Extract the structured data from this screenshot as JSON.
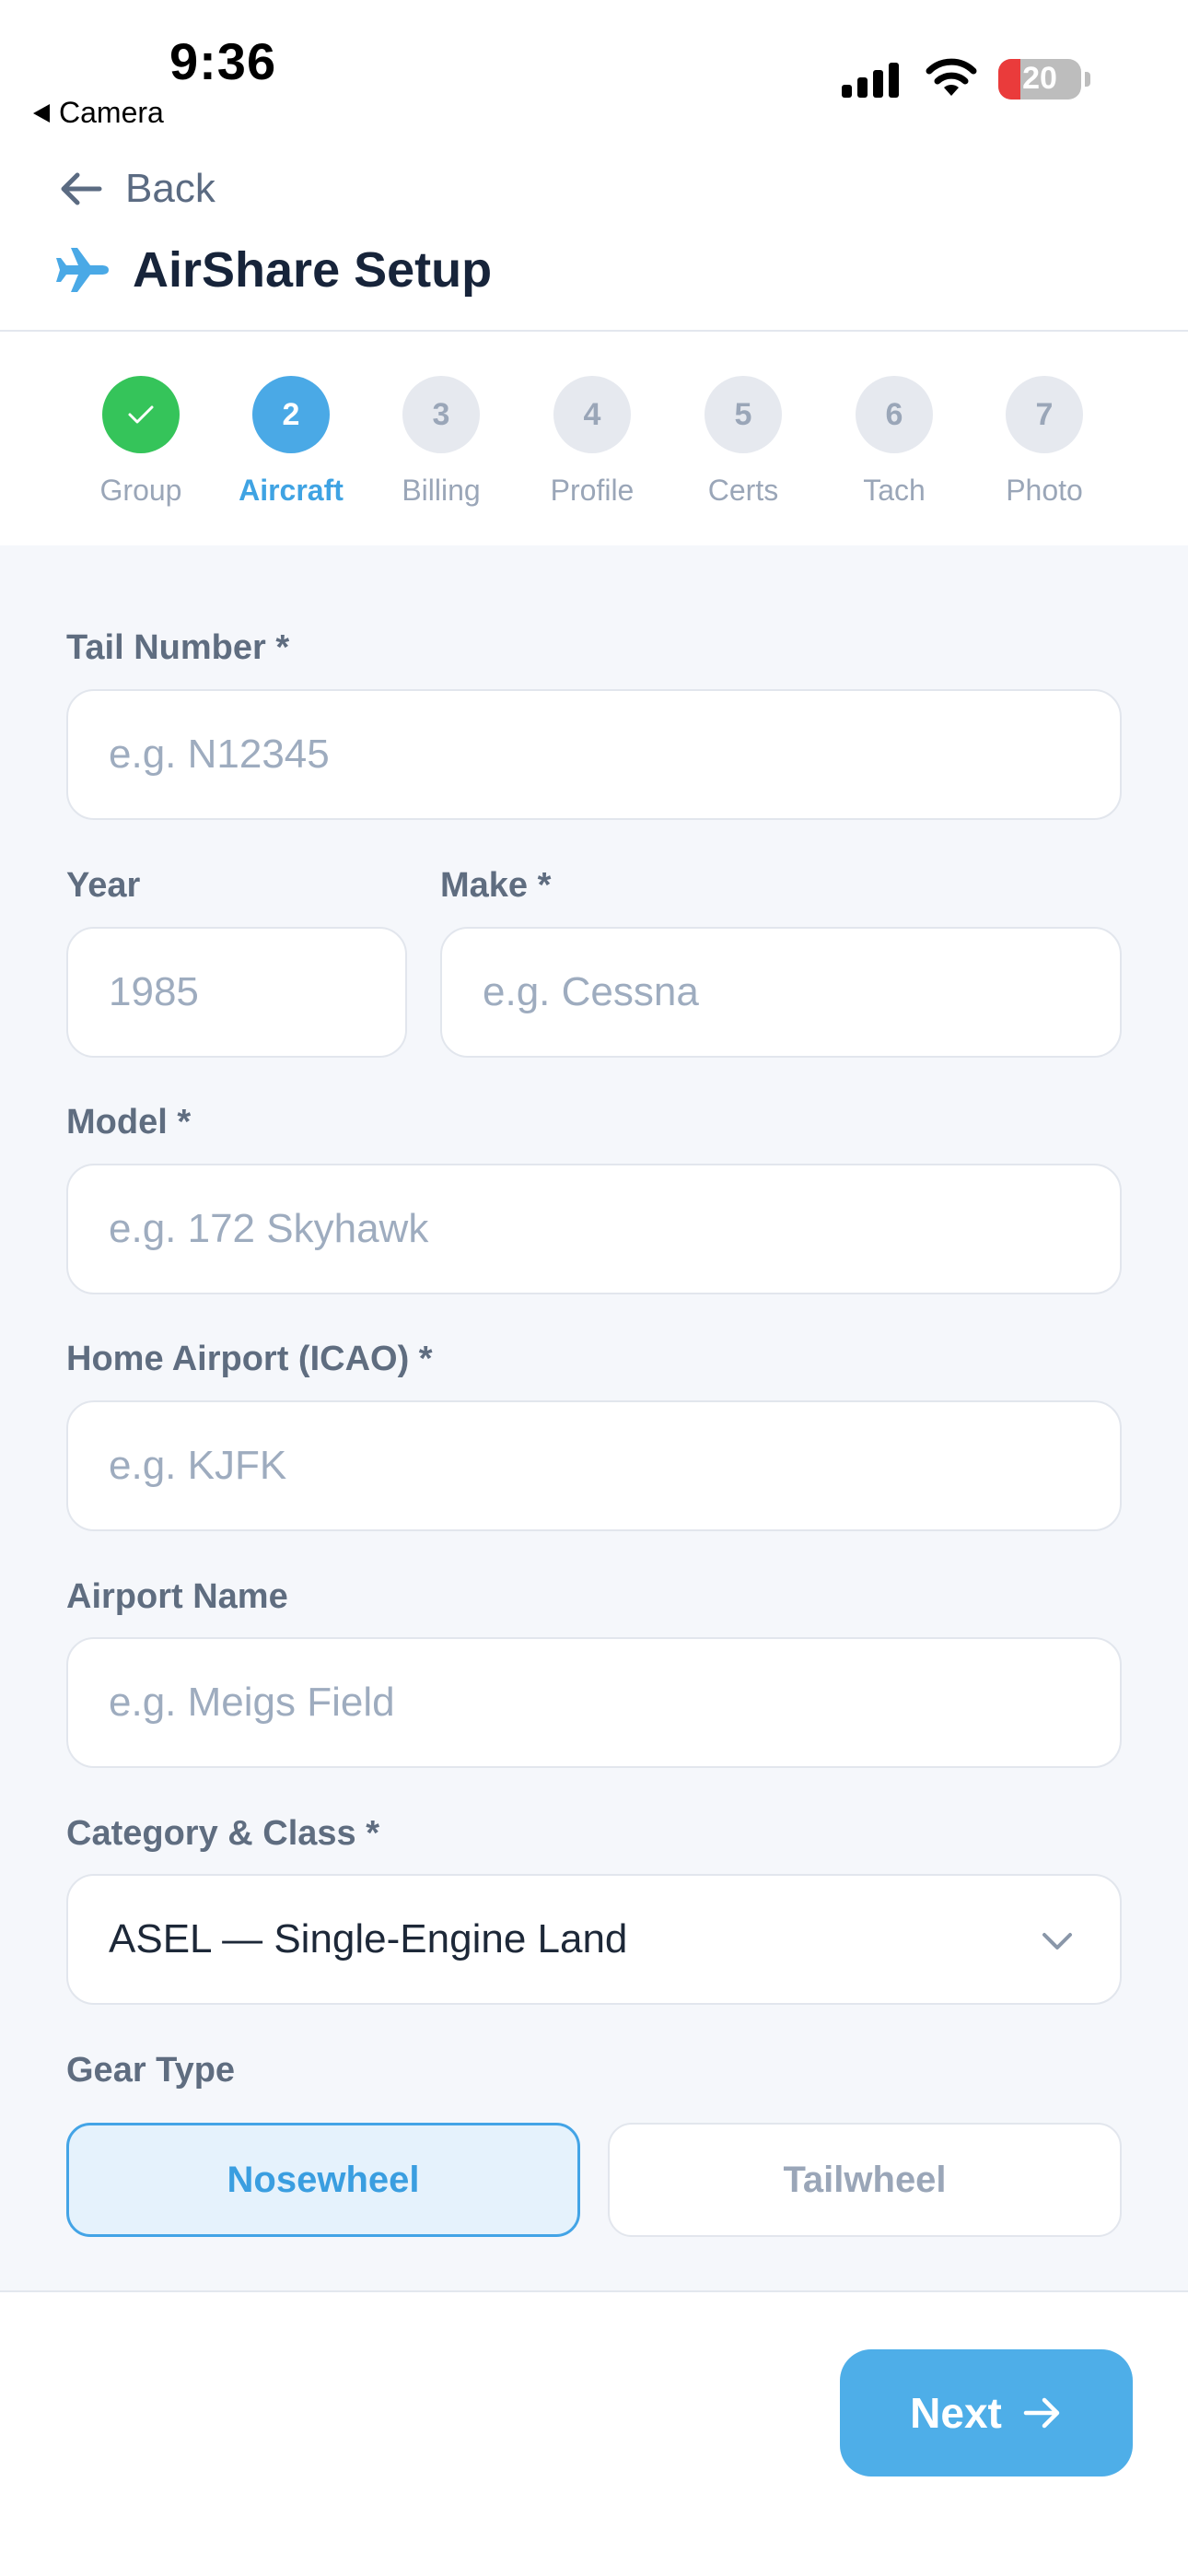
{
  "status_bar": {
    "time": "9:36",
    "back_app": "Camera",
    "battery": "20"
  },
  "header": {
    "back_label": "Back",
    "title": "AirShare Setup"
  },
  "stepper": {
    "steps": [
      {
        "number": "✓",
        "label": "Group",
        "state": "done"
      },
      {
        "number": "2",
        "label": "Aircraft",
        "state": "active"
      },
      {
        "number": "3",
        "label": "Billing",
        "state": "pending"
      },
      {
        "number": "4",
        "label": "Profile",
        "state": "pending"
      },
      {
        "number": "5",
        "label": "Certs",
        "state": "pending"
      },
      {
        "number": "6",
        "label": "Tach",
        "state": "pending"
      },
      {
        "number": "7",
        "label": "Photo",
        "state": "pending"
      }
    ]
  },
  "form": {
    "tail_number": {
      "label": "Tail Number *",
      "placeholder": "e.g. N12345"
    },
    "year": {
      "label": "Year",
      "placeholder": "1985"
    },
    "make": {
      "label": "Make *",
      "placeholder": "e.g. Cessna"
    },
    "model": {
      "label": "Model *",
      "placeholder": "e.g. 172 Skyhawk"
    },
    "home_airport": {
      "label": "Home Airport (ICAO) *",
      "placeholder": "e.g. KJFK"
    },
    "airport_name": {
      "label": "Airport Name",
      "placeholder": "e.g. Meigs Field"
    },
    "category_class": {
      "label": "Category & Class *",
      "value": "ASEL — Single-Engine Land"
    },
    "gear_type": {
      "label": "Gear Type",
      "options": [
        "Nosewheel",
        "Tailwheel"
      ],
      "selected": "Nosewheel"
    }
  },
  "footer": {
    "next_label": "Next"
  },
  "colors": {
    "accent": "#4aa9e6",
    "done": "#35c45a",
    "background": "#f5f7fb"
  }
}
